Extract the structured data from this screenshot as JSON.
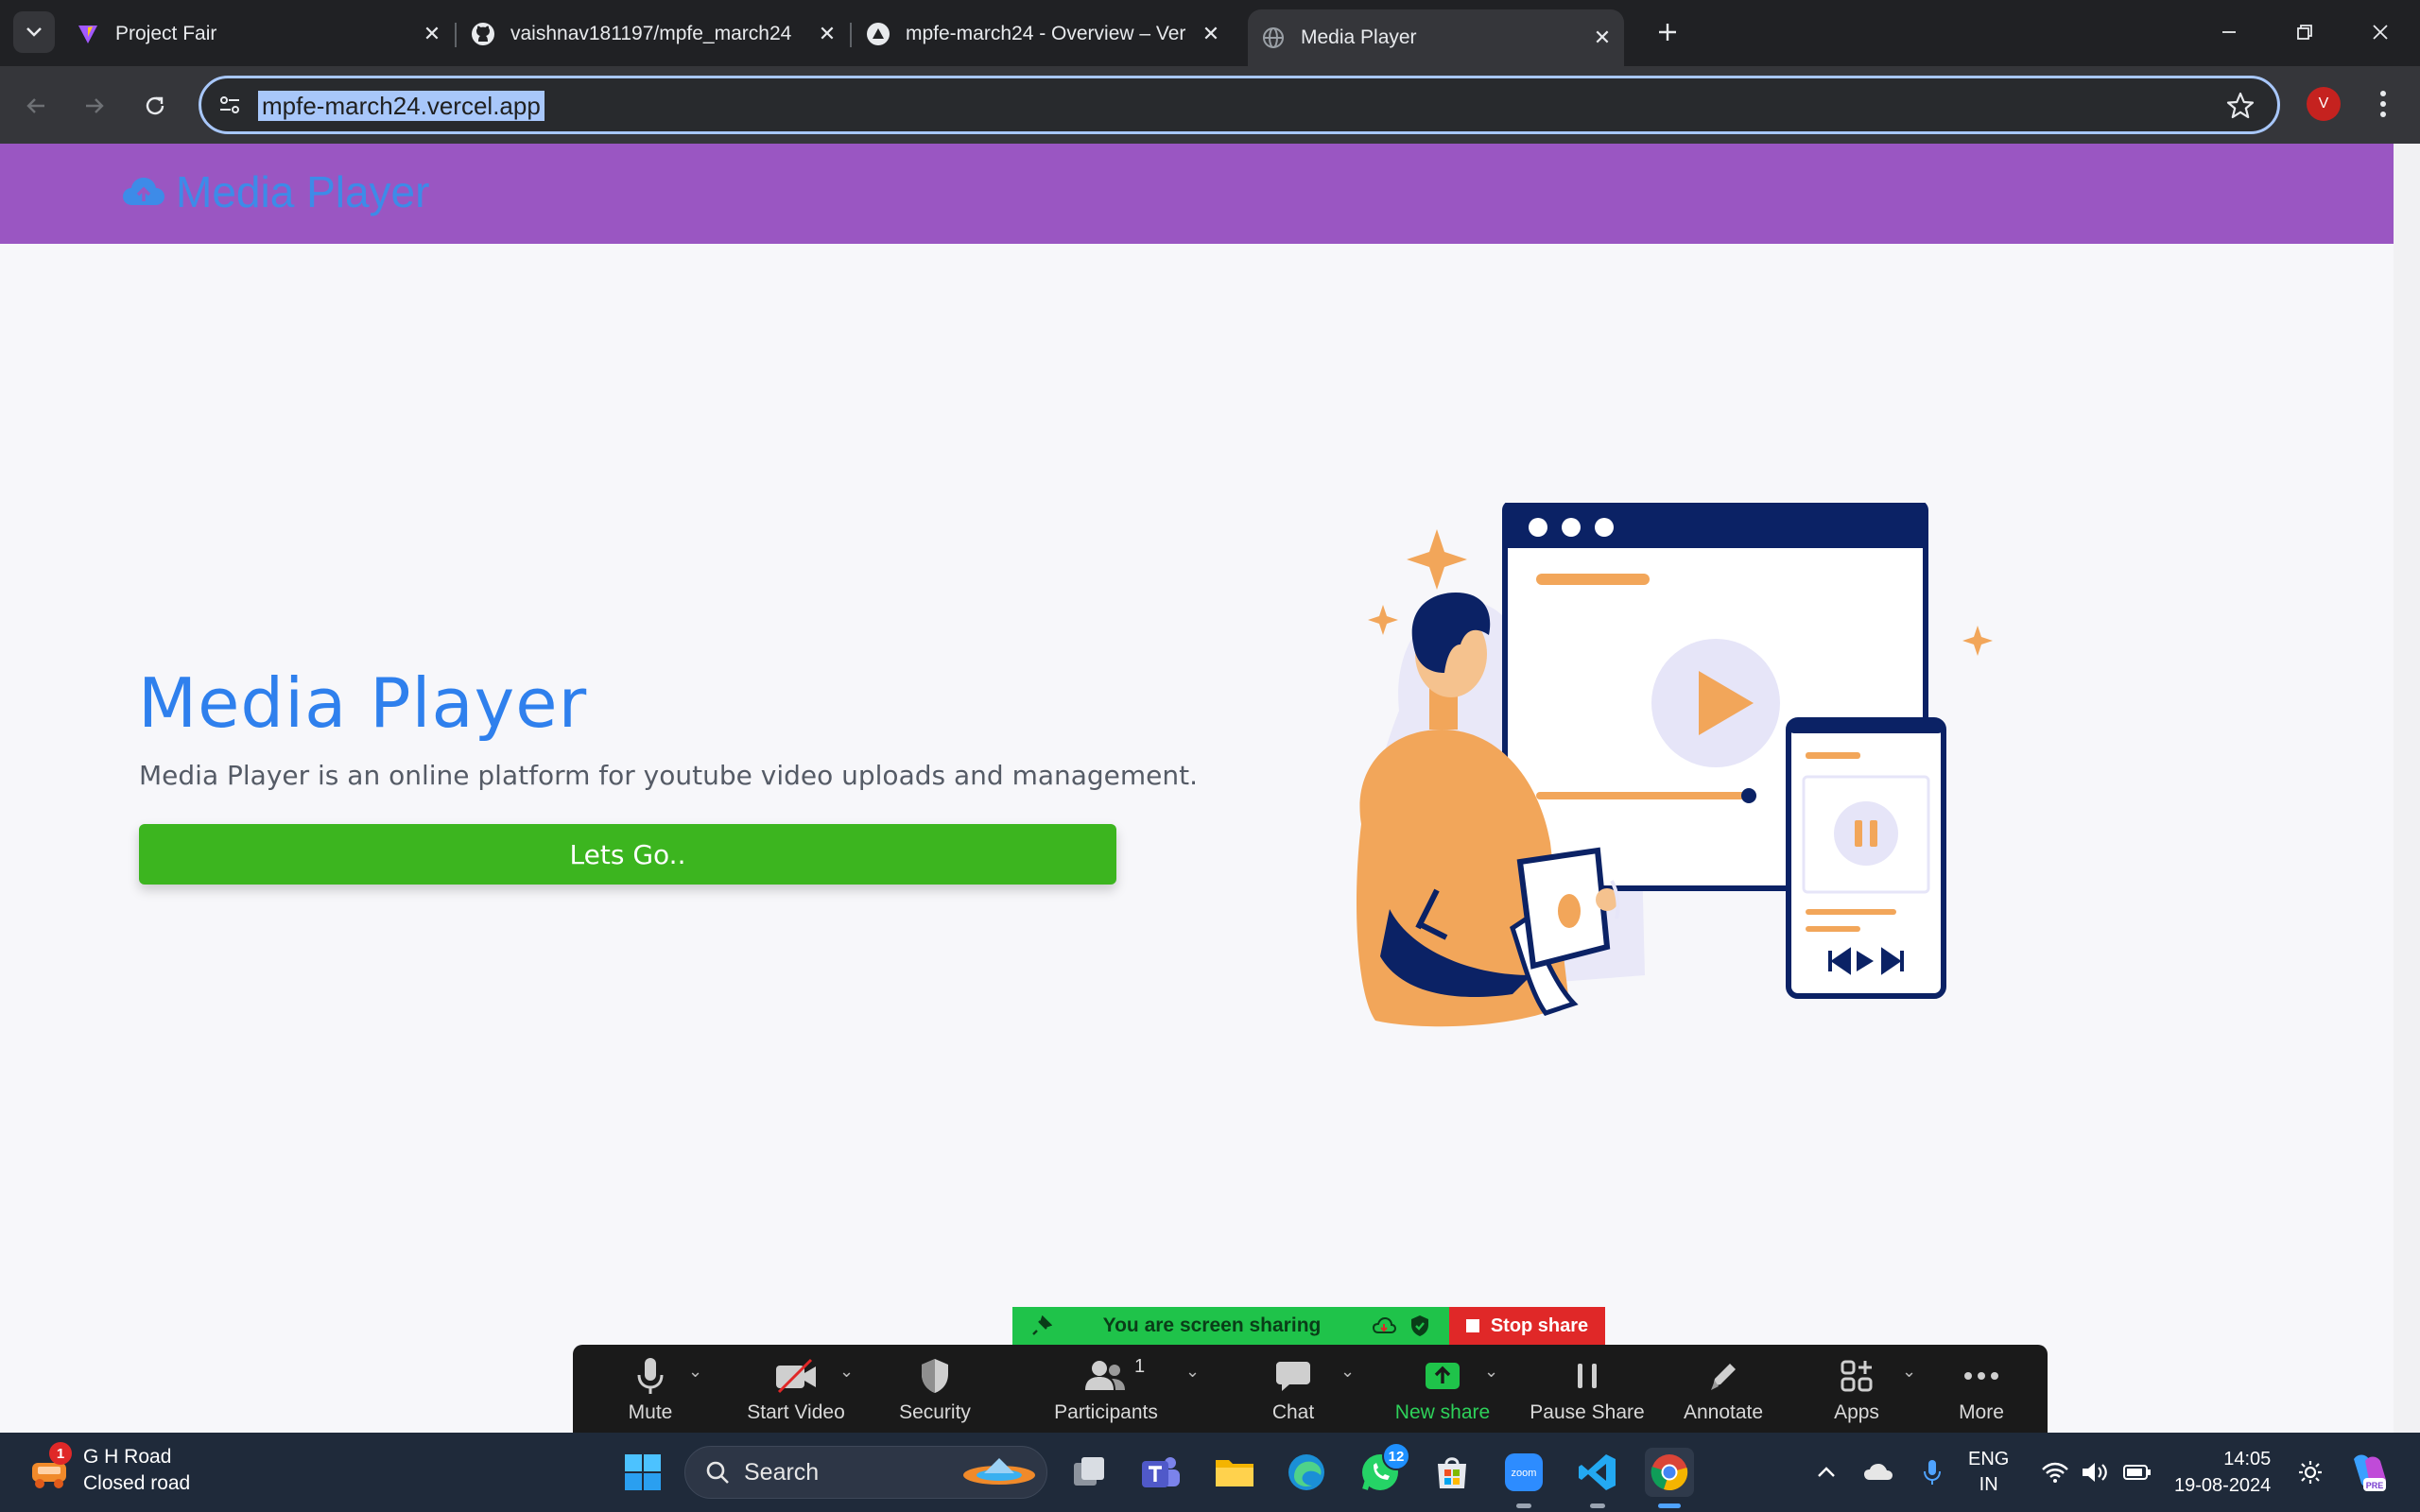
{
  "browser": {
    "tabs": [
      {
        "title": "Project Fair",
        "active": false
      },
      {
        "title": "vaishnav181197/mpfe_march24",
        "active": false
      },
      {
        "title": "mpfe-march24 - Overview – Ver",
        "active": false
      },
      {
        "title": "Media Player",
        "active": true
      }
    ],
    "url": "mpfe-march24.vercel.app",
    "profile_initial": "V"
  },
  "app": {
    "brand": "Media Player",
    "hero_title": "Media Player",
    "hero_description": "Media Player is an online platform for youtube video uploads and management.",
    "cta_label": "Lets Go.."
  },
  "zoom": {
    "banner": "You are screen sharing",
    "stop_share": "Stop share",
    "participants_count": "1",
    "controls": {
      "mute": "Mute",
      "start_video": "Start Video",
      "security": "Security",
      "participants": "Participants",
      "chat": "Chat",
      "new_share": "New share",
      "pause_share": "Pause Share",
      "annotate": "Annotate",
      "apps": "Apps",
      "more": "More"
    }
  },
  "taskbar": {
    "weather_line1": "G H Road",
    "weather_line2": "Closed road",
    "weather_badge": "1",
    "search_placeholder": "Search",
    "whatsapp_badge": "12",
    "lang_line1": "ENG",
    "lang_line2": "IN",
    "time": "14:05",
    "date": "19-08-2024"
  },
  "colors": {
    "header_purple": "#9a56c2",
    "brand_blue": "#2f80ed",
    "cta_green": "#3cb51f",
    "illustration_orange": "#f2a65a",
    "illustration_navy": "#0b2265"
  }
}
